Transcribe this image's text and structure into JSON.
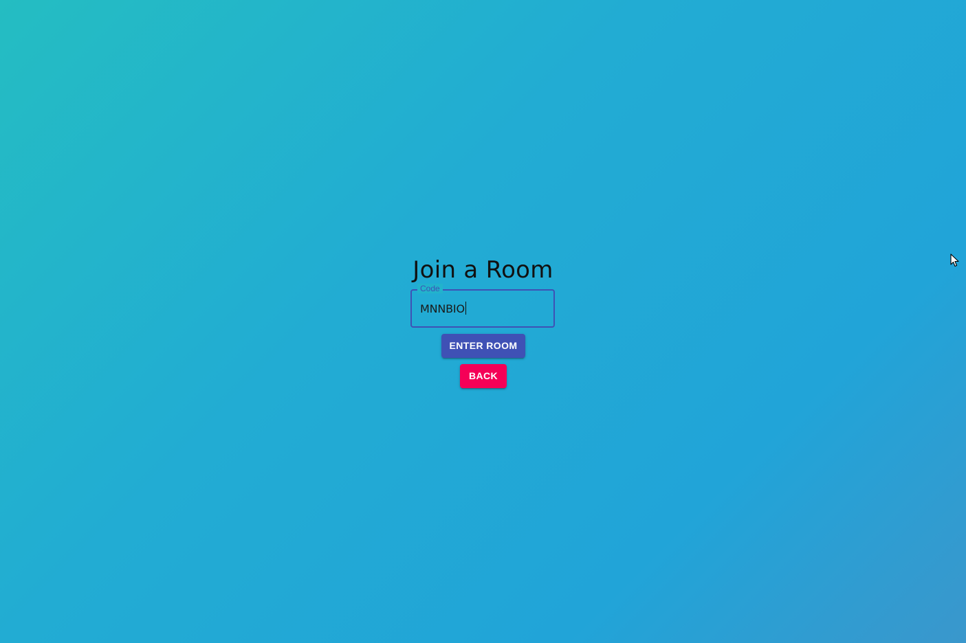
{
  "page": {
    "title": "Join a Room"
  },
  "code_field": {
    "label": "Code",
    "value": "MNNBIO"
  },
  "buttons": {
    "enter_label": "ENTER ROOM",
    "back_label": "BACK"
  },
  "colors": {
    "primary": "#3f51b5",
    "secondary": "#f50057",
    "background_start": "#24bdc2",
    "background_end": "#3a97cc"
  },
  "icons": {
    "pointer": "mouse-pointer-icon"
  }
}
